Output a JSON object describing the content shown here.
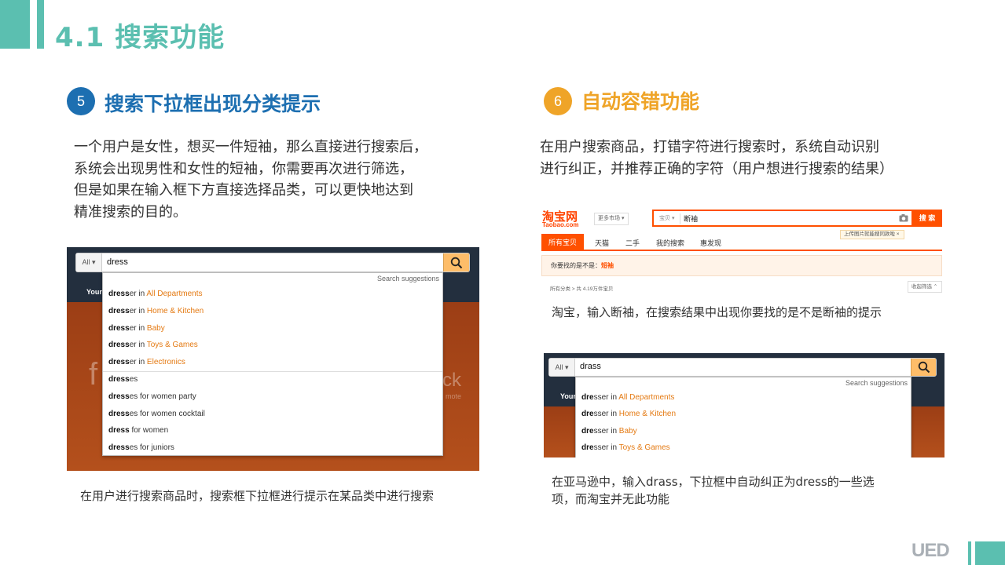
{
  "slide": {
    "title": "4.1 搜索功能"
  },
  "section5": {
    "number": "5",
    "title": "搜索下拉框出现分类提示",
    "lines": [
      "一个用户是女性，想买一件短袖，那么直接进行搜索后，",
      "系统会出现男性和女性的短袖，你需要再次进行筛选，",
      "但是如果在输入框下方直接选择品类，可以更快地达到",
      "精准搜索的目的。"
    ],
    "caption": "在用户进行搜索商品时，搜索框下拉框进行提示在某品类中进行搜索"
  },
  "section6": {
    "number": "6",
    "title": "自动容错功能",
    "lines": [
      "在用户搜索商品，打错字符进行搜索时，系统自动识别",
      "进行纠正，并推荐正确的字符（用户想进行搜索的结果）"
    ],
    "taobao_caption": "淘宝，输入断袖，在搜索结果中出现你要找的是不是断袖的提示",
    "amazon_caption_lines": [
      "在亚马逊中，输入drass，下拉框中自动纠正为dress的一些选",
      "项，而淘宝并无此功能"
    ]
  },
  "amazon1": {
    "all_label": "All",
    "query": "dress",
    "suggestions_header": "Search suggestions",
    "side_label": "Your",
    "ghost_left": "f",
    "ghost_right": "ck",
    "ghost_right_sub": "mote",
    "dept_suggestions": [
      {
        "bold": "dress",
        "rest": "er in ",
        "dept": "All Departments"
      },
      {
        "bold": "dress",
        "rest": "er in ",
        "dept": "Home & Kitchen"
      },
      {
        "bold": "dress",
        "rest": "er in ",
        "dept": "Baby"
      },
      {
        "bold": "dress",
        "rest": "er in ",
        "dept": "Toys & Games"
      },
      {
        "bold": "dress",
        "rest": "er in ",
        "dept": "Electronics"
      }
    ],
    "plain_suggestions": [
      {
        "bold": "dress",
        "rest": "es"
      },
      {
        "bold": "dress",
        "rest": "es for women party"
      },
      {
        "bold": "dress",
        "rest": "es for women cocktail"
      },
      {
        "bold": "dress",
        "rest": " for women"
      },
      {
        "bold": "dress",
        "rest": "es for juniors"
      }
    ]
  },
  "amazon2": {
    "all_label": "All",
    "query": "drass",
    "suggestions_header": "Search suggestions",
    "side_label": "Your",
    "dept_suggestions": [
      {
        "bold": "dre",
        "rest": "sser in ",
        "dept": "All Departments"
      },
      {
        "bold": "dre",
        "rest": "sser in ",
        "dept": "Home & Kitchen"
      },
      {
        "bold": "dre",
        "rest": "sser in ",
        "dept": "Baby"
      },
      {
        "bold": "dre",
        "rest": "sser in ",
        "dept": "Toys & Games"
      }
    ]
  },
  "taobao": {
    "logo": "淘宝网",
    "logo_sub": "Taobao.com",
    "market": "更多市场",
    "category": "宝贝",
    "query": "断袖",
    "search_button": "搜 索",
    "tip": "上传图片就能搜同款啦",
    "tabs": [
      "所有宝贝",
      "天猫",
      "二手",
      "我的搜索",
      "惠发现"
    ],
    "notice_prefix": "你要找的是不是：",
    "notice_keyword": "短袖",
    "crumb": "所有分类 > 共 4.19万件宝贝",
    "filter": "收起筛选"
  },
  "colors": {
    "teal": "#5bbfb0",
    "blue": "#1d6fb1",
    "orange": "#efa428",
    "amazon_orange": "#e47911",
    "taobao_orange": "#ff5000"
  },
  "footer": {
    "logo": "UED"
  }
}
